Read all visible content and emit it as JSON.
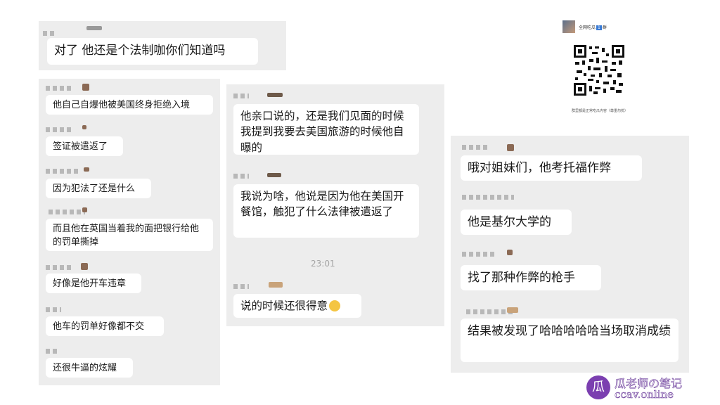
{
  "top_panel": {
    "message": "对了 他还是个法制咖你们知道吗"
  },
  "left_panel": {
    "messages": [
      "他自己自爆他被美国终身拒绝入境",
      "签证被遣返了",
      "因为犯法了还是什么",
      "而且他在英国当着我的面把银行给他的罚单撕掉",
      "好像是他开车违章",
      "他车的罚单好像都不交",
      "还很牛逼的炫耀"
    ]
  },
  "middle_panel": {
    "messages": [
      "他亲口说的，还是我们见面的时候我提到我要去美国旅游的时候他自曝的",
      "我说为啥，他说是因为他在美国开餐馆，触犯了什么法律被遣返了",
      "说的时候还很得意"
    ],
    "time": "23:01"
  },
  "qr_card": {
    "title": "全网吃瓜",
    "badge": "1",
    "title_suffix": "群",
    "caption": "群里都是正常吃瓜内容（尊重勿扰）"
  },
  "right_panel": {
    "messages": [
      "哦对姐妹们，他考托福作弊",
      "他是基尔大学的",
      "找了那种作弊的枪手",
      "结果被发现了哈哈哈哈哈当场取消成绩"
    ]
  },
  "watermark": {
    "brand": "瓜老师の笔记",
    "domain": "ccav.online",
    "icon_char": "瓜"
  }
}
